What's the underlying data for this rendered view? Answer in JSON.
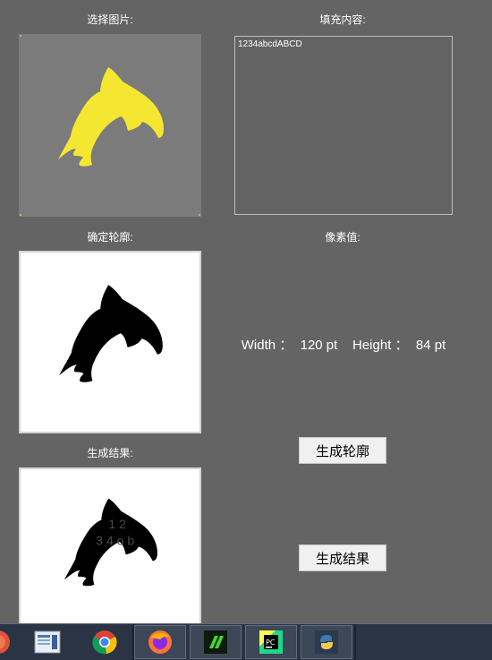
{
  "labels": {
    "select_image": "选择图片:",
    "fill_content": "填充内容:",
    "determine_contour": "确定轮廓:",
    "pixel_value": "像素值:",
    "generate_result": "生成结果:"
  },
  "fill_text": {
    "value": "1234abcdABCD"
  },
  "pixel_readout": {
    "width_label": "Width",
    "width_value": "120 pt",
    "height_label": "Height",
    "height_value": "84 pt"
  },
  "buttons": {
    "generate_contour": "生成轮廓",
    "generate_result": "生成结果"
  },
  "result_overlay": {
    "line1": "1 2",
    "line2": "3 4 o b"
  },
  "colors": {
    "background": "#646464",
    "dolphin_yellow": "#f5e631",
    "panel_gray": "#7b7b7b"
  },
  "taskbar": {
    "items": [
      "start-orb-icon",
      "file-manager-icon",
      "chrome-icon",
      "firefox-icon",
      "green-app-icon",
      "pycharm-icon",
      "python-icon"
    ]
  }
}
